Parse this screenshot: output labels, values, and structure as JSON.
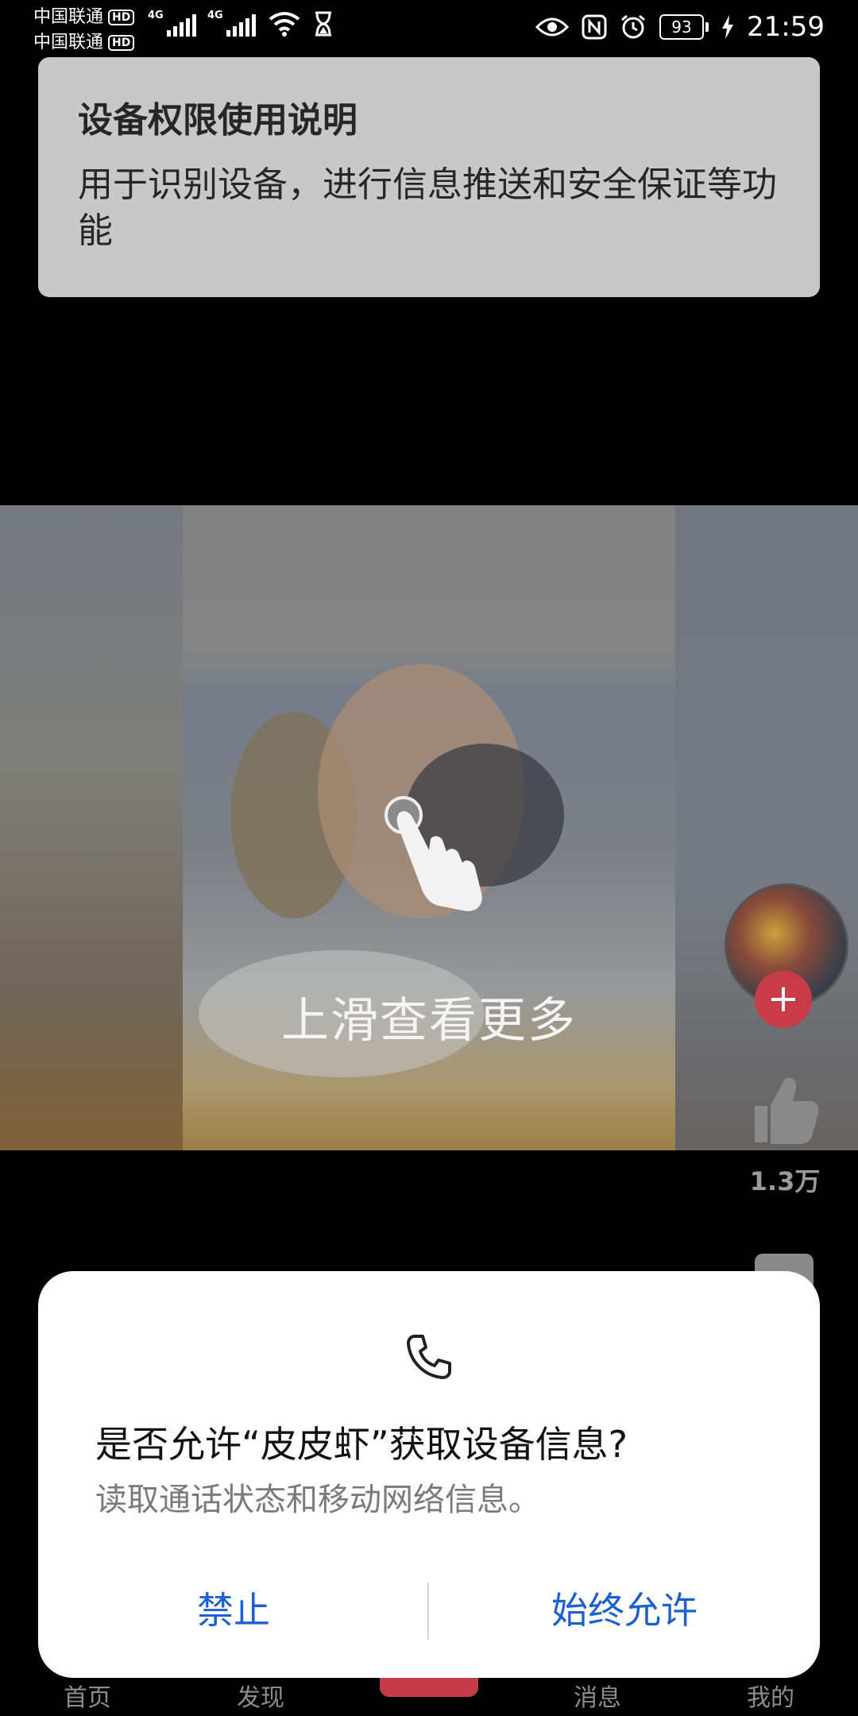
{
  "status_bar": {
    "carrier_1": "中国联通",
    "carrier_2": "中国联通",
    "hd_badge": "HD",
    "network_type": "4G",
    "battery_level": "93",
    "time": "21:59"
  },
  "permission_notice": {
    "title": "设备权限使用说明",
    "description": "用于识别设备，进行信息推送和安全保证等功能"
  },
  "video": {
    "swipe_hint": "上滑查看更多"
  },
  "actions": {
    "follow_symbol": "+",
    "like_count": "1.3万"
  },
  "bottom_nav": {
    "items": [
      "首页",
      "发现",
      "消息",
      "我的"
    ]
  },
  "dialog": {
    "title": "是否允许“皮皮虾”获取设备信息?",
    "description": "读取通话状态和移动网络信息。",
    "deny_label": "禁止",
    "allow_label": "始终允许",
    "accent_color": "#1a5fd6"
  }
}
